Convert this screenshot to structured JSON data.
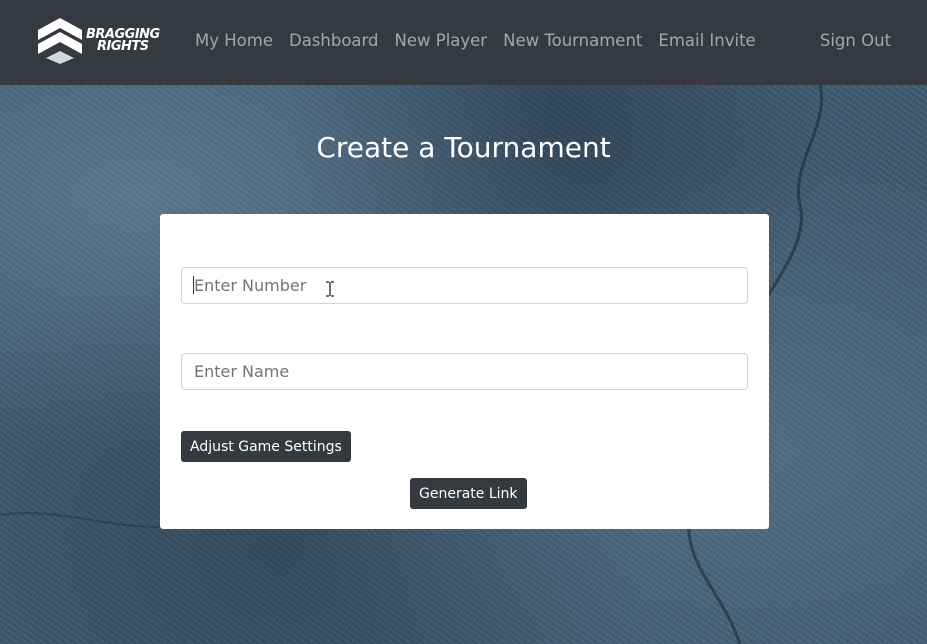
{
  "brand": {
    "line1": "BRAGGING",
    "line2": "RIGHTS"
  },
  "nav": {
    "items": [
      {
        "label": "My Home"
      },
      {
        "label": "Dashboard"
      },
      {
        "label": "New Player"
      },
      {
        "label": "New Tournament"
      },
      {
        "label": "Email Invite"
      }
    ],
    "sign_out": "Sign Out"
  },
  "page": {
    "title": "Create a Tournament"
  },
  "form": {
    "number_placeholder": "Enter Number",
    "number_value": "",
    "name_placeholder": "Enter Name",
    "name_value": "",
    "adjust_label": "Adjust Game Settings",
    "generate_label": "Generate Link"
  },
  "colors": {
    "navbar": "#343a40",
    "button": "#343a40",
    "card": "#ffffff",
    "nav_text": "rgba(255,255,255,0.55)"
  }
}
